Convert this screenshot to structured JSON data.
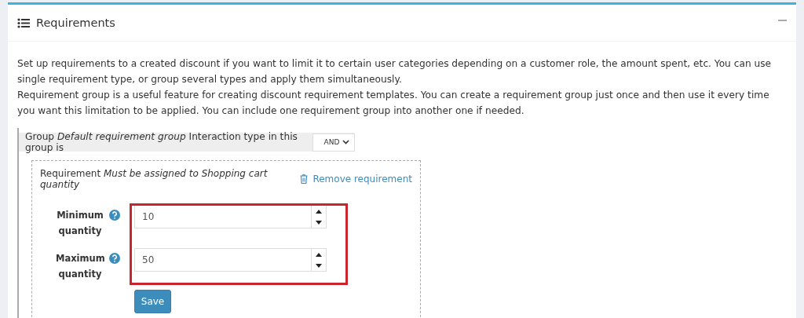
{
  "card": {
    "title": "Requirements"
  },
  "description": [
    "Set up requirements to a created discount if you want to limit it to certain user categories depending on a customer role, the amount spent, etc. You can use single requirement type, or group several types and apply them simultaneously.",
    "Requirement group is a useful feature for creating discount requirement templates. You can create a requirement group just once and then use it every time you want this limitation to be applied. You can include one requirement group into another one if needed."
  ],
  "group": {
    "label": "Group *Default requirement group* Interaction type in this group is",
    "interaction_type": "AND"
  },
  "requirement": {
    "label": "Requirement *Must be assigned to Shopping cart quantity*",
    "remove_link": "Remove requirement",
    "fields": [
      {
        "label": "Minimum quantity",
        "value": "10"
      },
      {
        "label": "Maximum quantity",
        "value": "50"
      }
    ],
    "highlighted": true,
    "save_button": "Save"
  }
}
